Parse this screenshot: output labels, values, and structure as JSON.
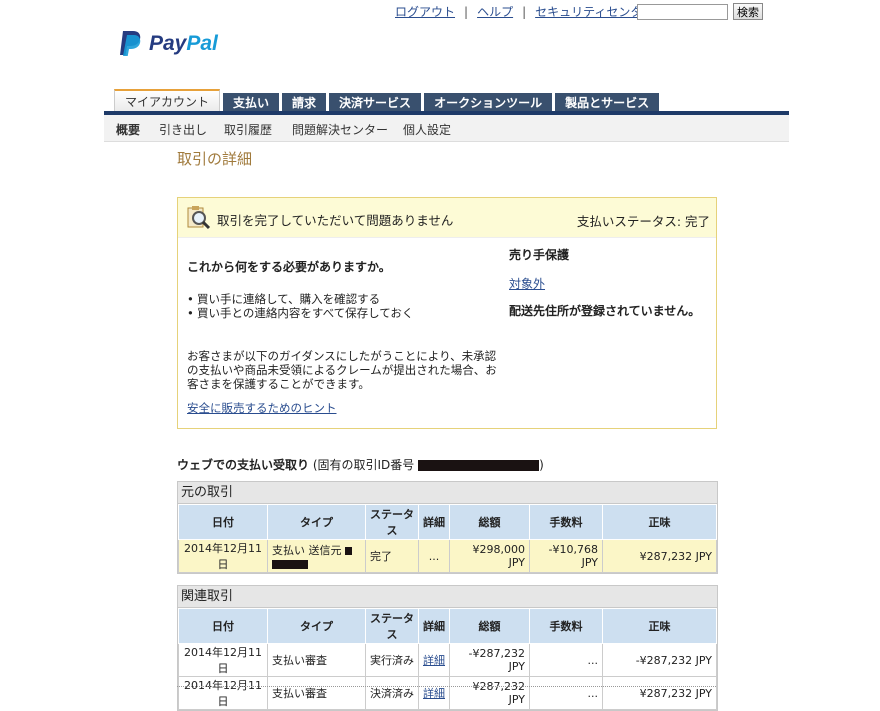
{
  "header": {
    "links": [
      "ログアウト",
      "ヘルプ",
      "セキュリティセンター"
    ],
    "search_button": "検索",
    "logo_pay": "Pay",
    "logo_pal": "Pal"
  },
  "tabs": [
    "マイアカウント",
    "支払い",
    "請求",
    "決済サービス",
    "オークションツール",
    "製品とサービス"
  ],
  "subnav": [
    "概要",
    "引き出し",
    "取引履歴",
    "問題解決センター",
    "個人設定"
  ],
  "page_title": "取引の詳細",
  "notice": {
    "message": "取引を完了していただいて問題ありません",
    "status": "支払いステータス: 完了",
    "question": "これから何をする必要がありますか。",
    "bullets": [
      "買い手に連絡して、購入を確認する",
      "買い手との連絡内容をすべて保存しておく"
    ],
    "paragraph": "お客さまが以下のガイダンスにしたがうことにより、未承認の支払いや商品未受領によるクレームが提出された場合、お客さまを保護することができます。",
    "tip_link": "安全に販売するためのヒント",
    "protection_title": "売り手保護",
    "protection_link": "対象外",
    "no_address": "配送先住所が登録されていません。"
  },
  "id_line": {
    "bold": "ウェブでの支払い受取り",
    "prefix": " (固有の取引ID番号 ",
    "suffix": ")"
  },
  "columns": [
    "日付",
    "タイプ",
    "ステータス",
    "詳細",
    "総額",
    "手数料",
    "正味"
  ],
  "original": {
    "caption": "元の取引",
    "row": {
      "date": "2014年12月11日",
      "type": "支払い 送信元",
      "status": "完了",
      "detail": "...",
      "gross": "¥298,000 JPY",
      "fee": "-¥10,768 JPY",
      "net": "¥287,232 JPY"
    }
  },
  "related": {
    "caption": "関連取引",
    "rows": [
      {
        "date": "2014年12月11日",
        "type": "支払い審査",
        "status": "実行済み",
        "detail": "詳細",
        "gross": "-¥287,232 JPY",
        "fee": "...",
        "net": "-¥287,232 JPY"
      },
      {
        "date": "2014年12月11日",
        "type": "支払い審査",
        "status": "決済済み",
        "detail": "詳細",
        "gross": "¥287,232 JPY",
        "fee": "...",
        "net": "¥287,232 JPY"
      }
    ]
  },
  "colors": {
    "nav_dark": "#39506e",
    "accent": "#e7a13a",
    "table_header": "#cddff0",
    "notice_bg": "#fdfbd6"
  }
}
